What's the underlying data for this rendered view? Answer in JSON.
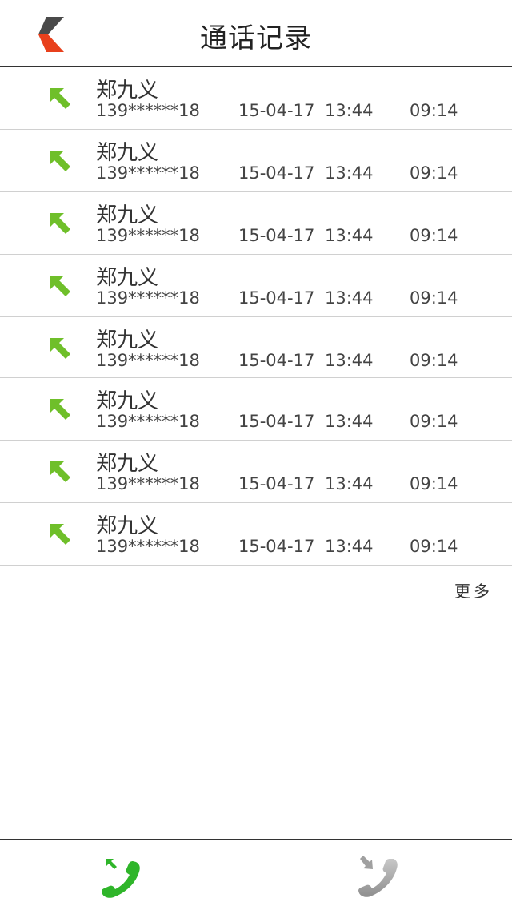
{
  "header": {
    "title": "通话记录",
    "back_icon": "chevron-left-icon",
    "back_colors": {
      "top": "#4a4a4a",
      "bottom": "#e8401c"
    }
  },
  "call_log": [
    {
      "name": "郑九义",
      "number": "139******18",
      "datetime": "15-04-17 13:44",
      "duration": "09:14",
      "direction": "outgoing"
    },
    {
      "name": "郑九义",
      "number": "139******18",
      "datetime": "15-04-17 13:44",
      "duration": "09:14",
      "direction": "outgoing"
    },
    {
      "name": "郑九义",
      "number": "139******18",
      "datetime": "15-04-17 13:44",
      "duration": "09:14",
      "direction": "outgoing"
    },
    {
      "name": "郑九义",
      "number": "139******18",
      "datetime": "15-04-17 13:44",
      "duration": "09:14",
      "direction": "outgoing"
    },
    {
      "name": "郑九义",
      "number": "139******18",
      "datetime": "15-04-17 13:44",
      "duration": "09:14",
      "direction": "outgoing"
    },
    {
      "name": "郑九义",
      "number": "139******18",
      "datetime": "15-04-17 13:44",
      "duration": "09:14",
      "direction": "outgoing"
    },
    {
      "name": "郑九义",
      "number": "139******18",
      "datetime": "15-04-17 13:44",
      "duration": "09:14",
      "direction": "outgoing"
    },
    {
      "name": "郑九义",
      "number": "139******18",
      "datetime": "15-04-17 13:44",
      "duration": "09:14",
      "direction": "outgoing"
    }
  ],
  "more": {
    "label": "更多"
  },
  "tabs": [
    {
      "id": "outgoing",
      "icon": "outgoing-call-icon",
      "active": true,
      "color": "#2fb52a"
    },
    {
      "id": "incoming",
      "icon": "incoming-call-icon",
      "active": false,
      "color": "#9a9a9a"
    }
  ],
  "colors": {
    "arrow_green": "#6fbf2a",
    "divider": "#d0d0d0",
    "accent_red": "#e8401c"
  }
}
